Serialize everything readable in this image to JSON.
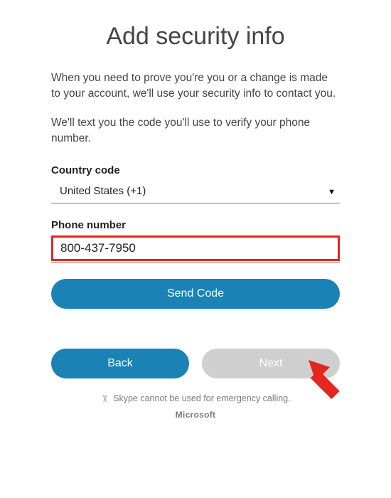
{
  "title": "Add security info",
  "intro": "When you need to prove you're you or a change is made to your account, we'll use your security info to contact you.",
  "helper": "We'll text you the code you'll use to verify your phone number.",
  "country": {
    "label": "Country code",
    "selected": "United States (+1)"
  },
  "phone": {
    "label": "Phone number",
    "value": "800-437-7950"
  },
  "buttons": {
    "send": "Send Code",
    "back": "Back",
    "next": "Next"
  },
  "disclaimer": "Skype cannot be used for emergency calling.",
  "brand": "Microsoft"
}
